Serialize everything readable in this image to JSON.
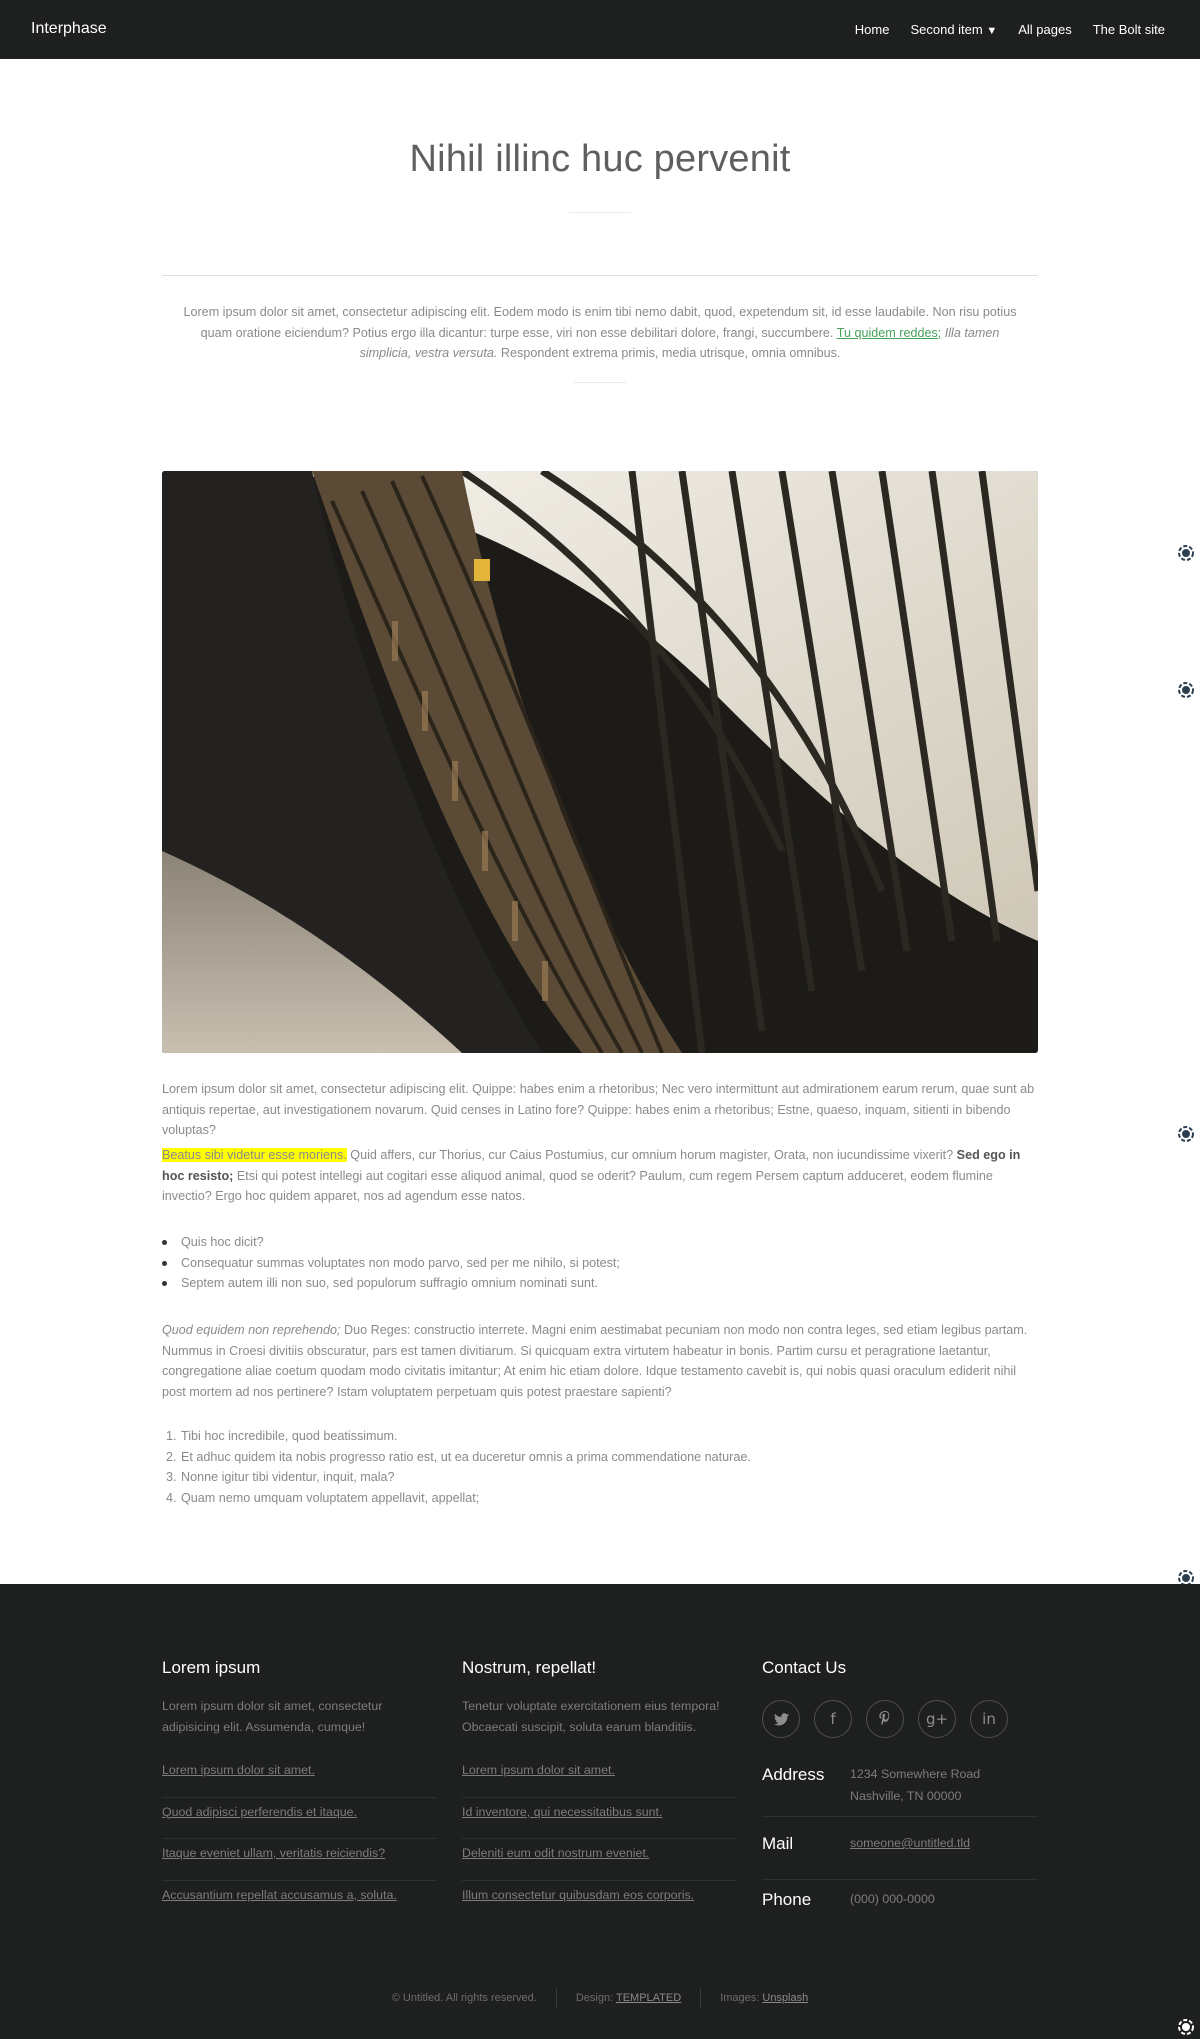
{
  "header": {
    "brand": "Interphase",
    "nav": [
      {
        "label": "Home"
      },
      {
        "label": "Second item",
        "caret": "▼"
      },
      {
        "label": "All pages"
      },
      {
        "label": "The Bolt site"
      }
    ]
  },
  "hero": {
    "title": "Nihil illinc huc pervenit",
    "intro_text_1": "Lorem ipsum dolor sit amet, consectetur adipiscing elit. Eodem modo is enim tibi nemo dabit, quod, expetendum sit, id esse laudabile. Non risu potius quam oratione eiciendum? Potius ergo illa dicantur: turpe esse, viri non esse debilitari dolore, frangi, succumbere. ",
    "intro_link": "Tu quidem reddes;",
    "intro_italic": " Illa tamen simplicia, vestra versuta.",
    "intro_text_2": " Respondent extrema primis, media utrisque, omnia omnibus."
  },
  "content": {
    "image_alt": "library bookshelves curving under skylight",
    "p1": "Lorem ipsum dolor sit amet, consectetur adipiscing elit. Quippe: habes enim a rhetoribus; Nec vero intermittunt aut admirationem earum rerum, quae sunt ab antiquis repertae, aut investigationem novarum. Quid censes in Latino fore? Quippe: habes enim a rhetoribus; Estne, quaeso, inquam, sitienti in bibendo voluptas?",
    "p2_mark": "Beatus sibi videtur esse moriens.",
    "p2_text_1": " Quid affers, cur Thorius, cur Caius Postumius, cur omnium horum magister, Orata, non iucundissime vixerit? ",
    "p2_strong": "Sed ego in hoc resisto;",
    "p2_text_2": " Etsi qui potest intellegi aut cogitari esse aliquod animal, quod se oderit? Paulum, cum regem Persem captum adduceret, eodem flumine invectio? Ergo hoc quidem apparet, nos ad agendum esse natos.",
    "bullets": [
      "Quis hoc dicit?",
      "Consequatur summas voluptates non modo parvo, sed per me nihilo, si potest;",
      "Septem autem illi non suo, sed populorum suffragio omnium nominati sunt."
    ],
    "p3_italic": "Quod equidem non reprehendo;",
    "p3_text": " Duo Reges: constructio interrete. Magni enim aestimabat pecuniam non modo non contra leges, sed etiam legibus partam. Nummus in Croesi divitiis obscuratur, pars est tamen divitiarum. Si quicquam extra virtutem habeatur in bonis. Partim cursu et peragratione laetantur, congregatione aliae coetum quodam modo civitatis imitantur; At enim hic etiam dolore. Idque testamento cavebit is, qui nobis quasi oraculum ediderit nihil post mortem ad nos pertinere? Istam voluptatem perpetuam quis potest praestare sapienti?",
    "ordered": [
      {
        "num": "1.",
        "text": "Tibi hoc incredibile, quod beatissimum."
      },
      {
        "num": "2.",
        "text": "Et adhuc quidem ita nobis progresso ratio est, ut ea duceretur omnis a prima commendatione naturae."
      },
      {
        "num": "3.",
        "text": "Nonne igitur tibi videntur, inquit, mala?"
      },
      {
        "num": "4.",
        "text": "Quam nemo umquam voluptatem appellavit, appellat;"
      }
    ]
  },
  "footer": {
    "col1": {
      "heading": "Lorem ipsum",
      "desc": "Lorem ipsum dolor sit amet, consectetur adipisicing elit. Assumenda, cumque!",
      "links": [
        "Lorem ipsum dolor sit amet.",
        "Quod adipisci perferendis et itaque.",
        "Itaque eveniet ullam, veritatis reiciendis?",
        "Accusantium repellat accusamus a, soluta."
      ]
    },
    "col2": {
      "heading": "Nostrum, repellat!",
      "desc": "Tenetur voluptate exercitationem eius tempora! Obcaecati suscipit, soluta earum blanditiis.",
      "links": [
        "Lorem ipsum dolor sit amet.",
        "Id inventore, qui necessitatibus sunt.",
        "Deleniti eum odit nostrum eveniet.",
        "Illum consectetur quibusdam eos corporis."
      ]
    },
    "col3": {
      "heading": "Contact Us",
      "socials": [
        {
          "icon": "twitter-icon",
          "glyph": "🐦"
        },
        {
          "icon": "facebook-icon",
          "glyph": "f"
        },
        {
          "icon": "pinterest-icon",
          "glyph": "p"
        },
        {
          "icon": "google-plus-icon",
          "glyph": "g+"
        },
        {
          "icon": "linkedin-icon",
          "glyph": "in"
        }
      ],
      "address_label": "Address",
      "address_line1": "1234 Somewhere Road",
      "address_line2": "Nashville, TN 00000",
      "mail_label": "Mail",
      "mail_value": "someone@untitled.tld",
      "phone_label": "Phone",
      "phone_value": "(000) 000-0000"
    },
    "copyright": {
      "text": "© Untitled. All rights reserved.",
      "design_label": "Design: ",
      "design_link": "TEMPLATED",
      "images_label": "Images: ",
      "images_link": "Unsplash"
    }
  },
  "colors": {
    "header_bg": "#1e1f1f",
    "link_green": "#49a15c",
    "highlight": "#ffff00",
    "side_icon": "#2c3e50"
  }
}
